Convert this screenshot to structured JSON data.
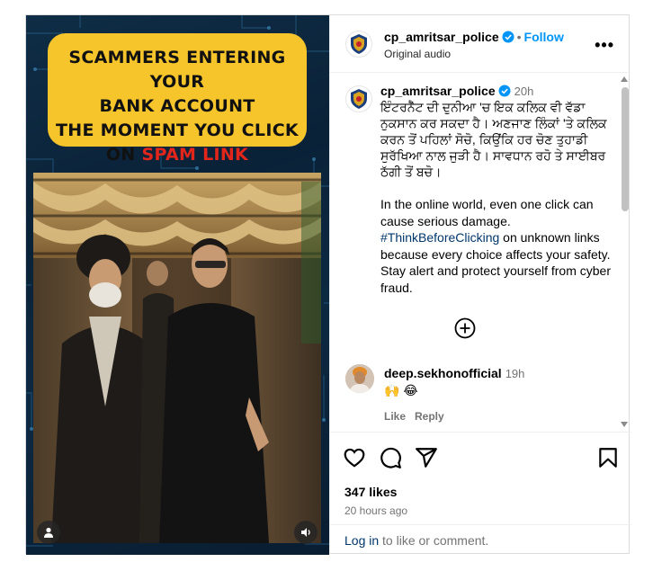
{
  "post": {
    "author": "cp_amritsar_police",
    "follow_label": "Follow",
    "audio_label": "Original audio",
    "more_label": "•••",
    "media": {
      "headline_line1": "SCAMMERS ENTERING YOUR",
      "headline_line2": "BANK ACCOUNT",
      "headline_line3": "THE MOMENT YOU CLICK",
      "headline_line4_prefix": "ON ",
      "headline_line4_highlight": "SPAM LINK",
      "headline_color": "#f6c52b",
      "highlight_color": "#e3261b",
      "user_icon": "user-icon",
      "sound_icon": "sound-icon"
    },
    "caption": {
      "author": "cp_amritsar_police",
      "time": "20h",
      "punjabi_text": "ਇੰਟਰਨੈੱਟ ਦੀ ਦੁਨੀਆ 'ਚ ਇਕ ਕਲਿਕ ਵੀ ਵੱਡਾ ਨੁਕਸਾਨ ਕਰ ਸਕਦਾ ਹੈ। ਅਣਜਾਣ ਲਿੰਕਾਂ 'ਤੇ ਕਲਿਕ ਕਰਨ ਤੋਂ ਪਹਿਲਾਂ ਸੋਚੋ, ਕਿਉਂਕਿ ਹਰ ਚੋਣ ਤੁਹਾਡੀ ਸੁਰੱਖਿਆ ਨਾਲ ਜੁੜੀ ਹੈ। ਸਾਵਧਾਨ ਰਹੋ ਤੇ ਸਾਈਬਰ ਠੱਗੀ ਤੋਂ ਬਚੋ।",
      "english_before": "In the online world, even one click can cause serious damage. ",
      "hashtag": "#ThinkBeforeClicking",
      "english_after": " on unknown links because every choice affects your safety. Stay alert and protect yourself from cyber fraud."
    },
    "comments": [
      {
        "author": "deep.sekhonofficial",
        "time": "19h",
        "text": "🙌 😂",
        "like_label": "Like",
        "reply_label": "Reply"
      }
    ],
    "likes": "347 likes",
    "posted_ago": "20 hours ago",
    "login_link": "Log in",
    "login_suffix": " to like or comment.",
    "colors": {
      "link_blue": "#0095f6",
      "verified_blue": "#0095f6",
      "muted": "#737373"
    }
  }
}
